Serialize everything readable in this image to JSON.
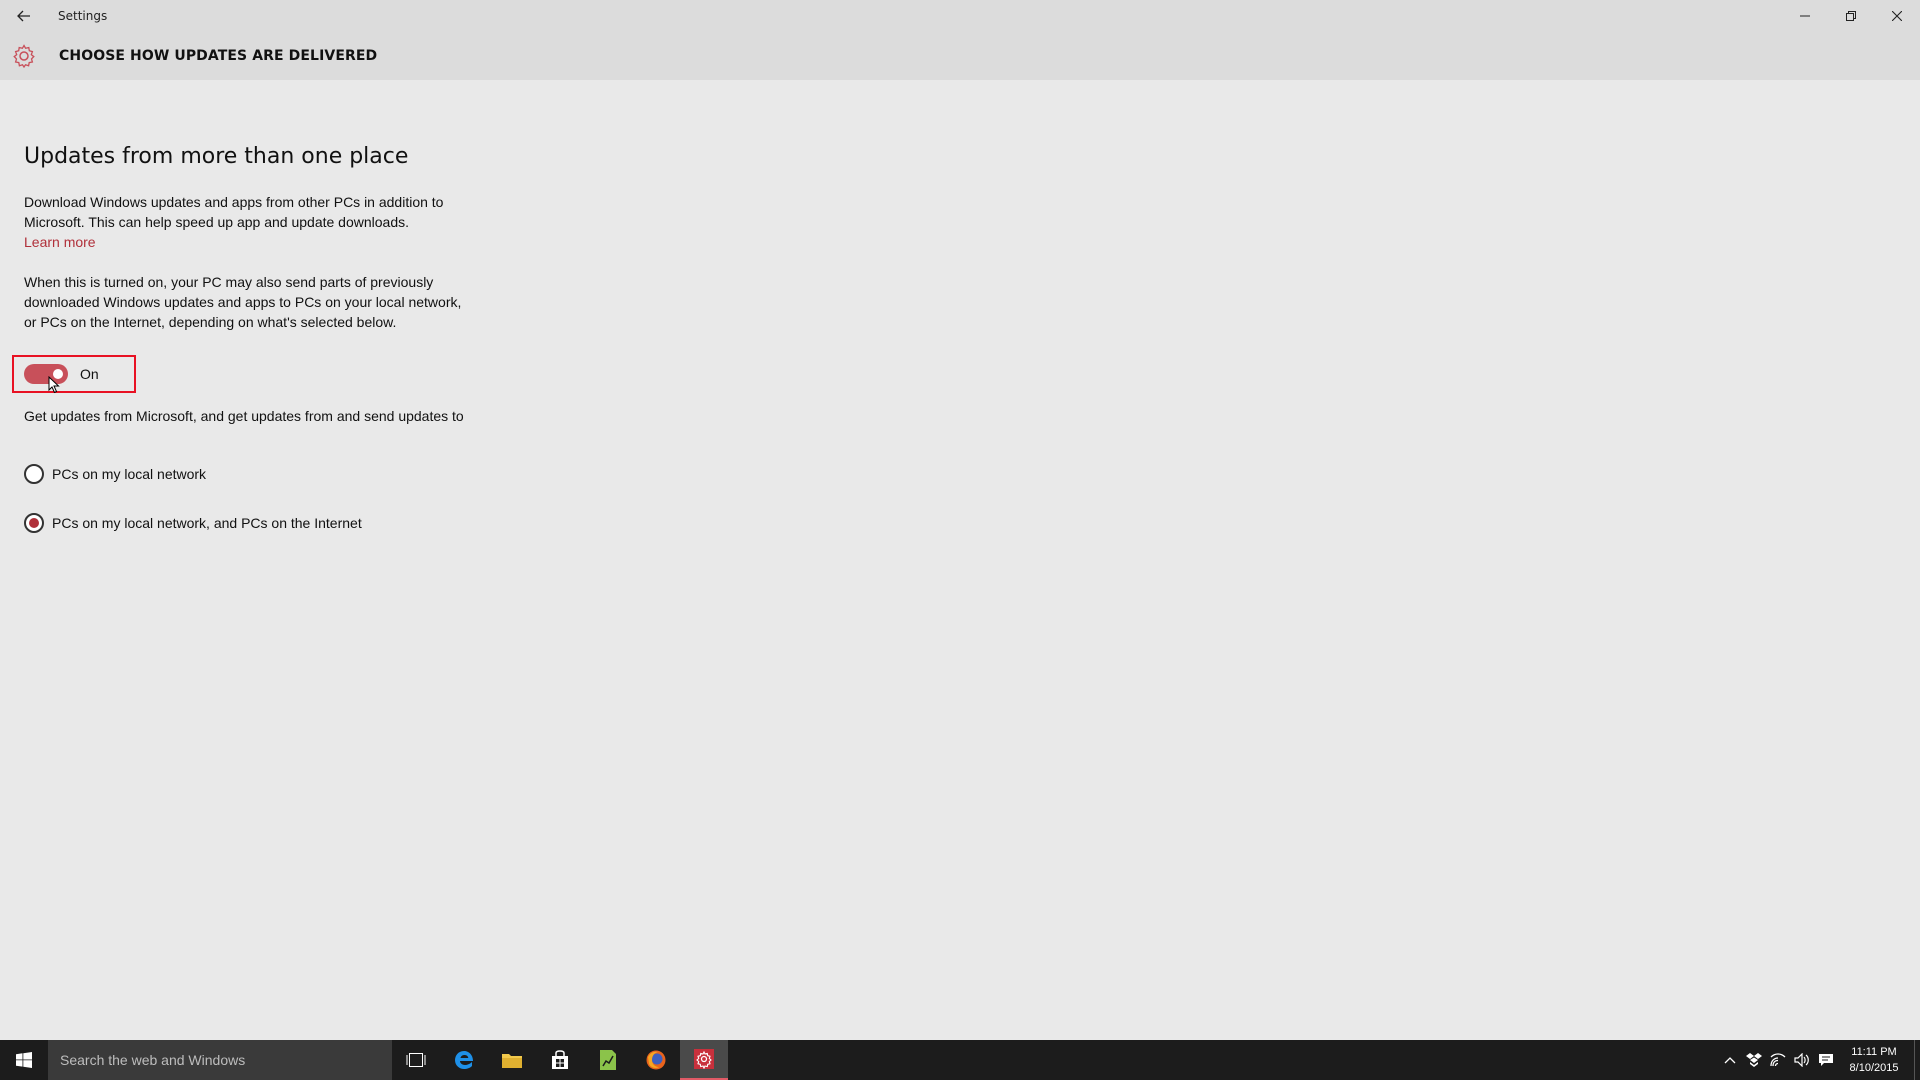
{
  "window": {
    "title": "Settings"
  },
  "header": {
    "title": "CHOOSE HOW UPDATES ARE DELIVERED"
  },
  "content": {
    "section_title": "Updates from more than one place",
    "paragraph1": "Download Windows updates and apps from other PCs in addition to Microsoft. This can help speed up app and update downloads.",
    "learn_more": "Learn more",
    "paragraph2": "When this is turned on, your PC may also send parts of previously downloaded Windows updates and apps to PCs on your local network, or PCs on the Internet, depending on what's selected below.",
    "toggle": {
      "state_label": "On",
      "on": true
    },
    "paragraph3": "Get updates from Microsoft, and get updates from and send updates to",
    "options": [
      {
        "label": "PCs on my local network",
        "selected": false
      },
      {
        "label": "PCs on my local network, and PCs on the Internet",
        "selected": true
      }
    ]
  },
  "taskbar": {
    "search_placeholder": "Search the web and Windows",
    "pinned": [
      "task-view-icon",
      "edge-icon",
      "file-explorer-icon",
      "store-icon",
      "spreadsheet-icon",
      "firefox-icon",
      "settings-icon"
    ],
    "clock": {
      "time": "11:11 PM",
      "date": "8/10/2015"
    }
  },
  "colors": {
    "accent": "#c8505a",
    "link": "#b0303a",
    "highlight_border": "#e81123"
  }
}
